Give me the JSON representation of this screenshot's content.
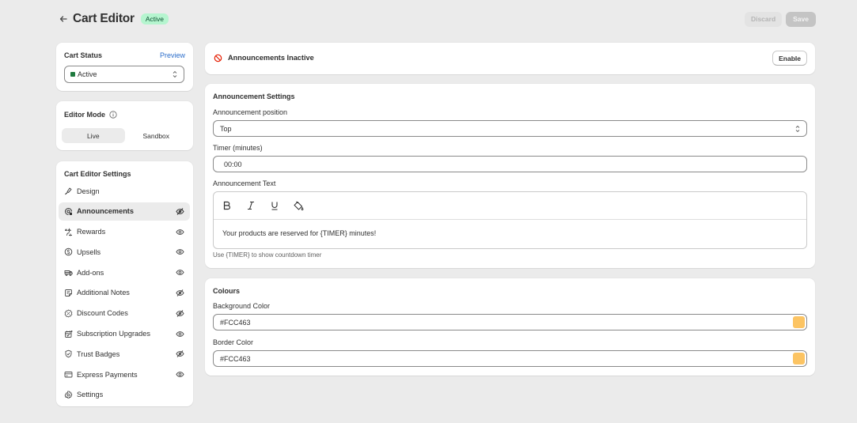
{
  "header": {
    "title": "Cart Editor",
    "status_badge": "Active",
    "discard_label": "Discard",
    "save_label": "Save"
  },
  "cart_status": {
    "title": "Cart Status",
    "preview_label": "Preview",
    "selected": "Active",
    "indicator_color": "#1f7a3f"
  },
  "editor_mode": {
    "title": "Editor Mode",
    "options": [
      "Live",
      "Sandbox"
    ],
    "selected": "Live"
  },
  "settings_nav": {
    "title": "Cart Editor Settings",
    "items": [
      {
        "label": "Design",
        "icon": "paintbrush-icon",
        "visibility": null
      },
      {
        "label": "Announcements",
        "icon": "megaphone-icon",
        "visibility": "hidden",
        "active": true
      },
      {
        "label": "Rewards",
        "icon": "sparkle-icon",
        "visibility": "visible"
      },
      {
        "label": "Upsells",
        "icon": "dollar-circle-icon",
        "visibility": "visible"
      },
      {
        "label": "Add-ons",
        "icon": "truck-icon",
        "visibility": "visible"
      },
      {
        "label": "Additional Notes",
        "icon": "note-icon",
        "visibility": "hidden"
      },
      {
        "label": "Discount Codes",
        "icon": "discount-icon",
        "visibility": "hidden"
      },
      {
        "label": "Subscription Upgrades",
        "icon": "subscription-icon",
        "visibility": "visible"
      },
      {
        "label": "Trust Badges",
        "icon": "shield-check-icon",
        "visibility": "hidden"
      },
      {
        "label": "Express Payments",
        "icon": "credit-card-icon",
        "visibility": "visible"
      },
      {
        "label": "Settings",
        "icon": "gear-icon",
        "visibility": null
      }
    ]
  },
  "banner": {
    "text": "Announcements Inactive",
    "enable_label": "Enable"
  },
  "announcement_settings": {
    "title": "Announcement Settings",
    "position_label": "Announcement position",
    "position_value": "Top",
    "timer_label": "Timer (minutes)",
    "timer_value": "00:00",
    "text_label": "Announcement Text",
    "toolbar": [
      "Bold",
      "Italic",
      "Underline",
      "Fill color"
    ],
    "text_value": "Your products are reserved for {TIMER} minutes!",
    "help_text": "Use {TIMER} to show countdown timer"
  },
  "colours": {
    "title": "Colours",
    "background_label": "Background Color",
    "background_value": "#FCC463",
    "border_label": "Border Color",
    "border_value": "#FCC463"
  }
}
